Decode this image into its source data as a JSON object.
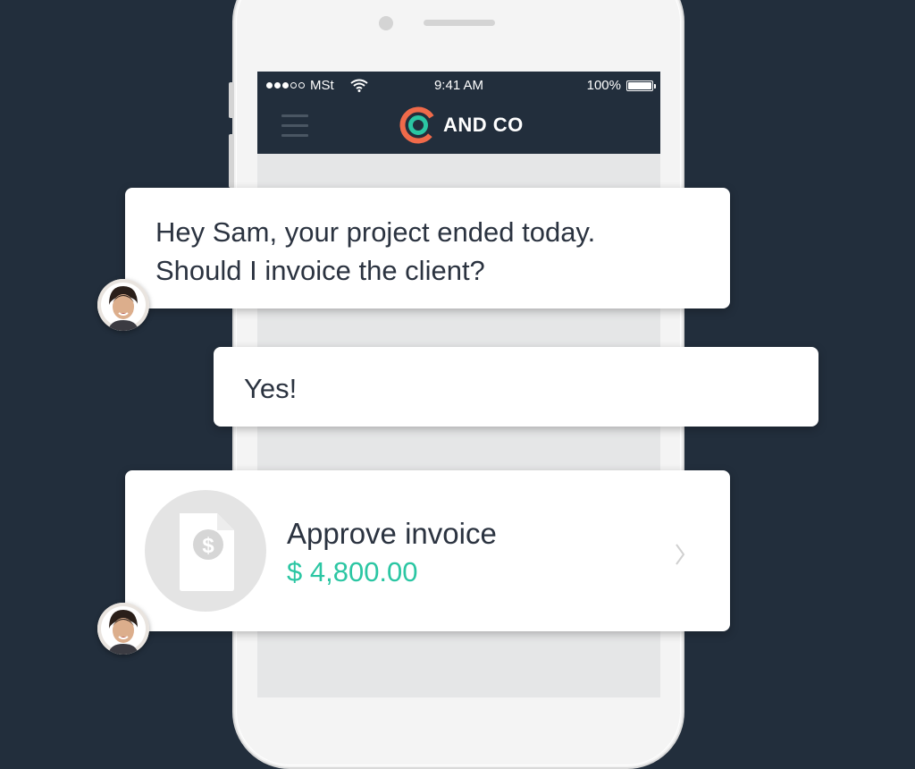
{
  "status_bar": {
    "carrier": "MSt",
    "time": "9:41 AM",
    "battery": "100%"
  },
  "app_header": {
    "brand": "AND CO",
    "menu_icon": "hamburger-icon",
    "logo_icon": "and-co-logo-icon"
  },
  "messages": [
    {
      "sender": "assistant",
      "text": "Hey Sam, your project ended today.\nShould I invoice the client?"
    },
    {
      "sender": "user",
      "text": "Yes!"
    }
  ],
  "invoice_card": {
    "title": "Approve invoice",
    "amount": "$ 4,800.00",
    "icon": "invoice-dollar-icon",
    "action_icon": "chevron-right-icon"
  },
  "colors": {
    "background": "#222e3c",
    "accent_green": "#2bc6a3",
    "accent_orange": "#f06a4a",
    "text_dark": "#2b3340"
  }
}
